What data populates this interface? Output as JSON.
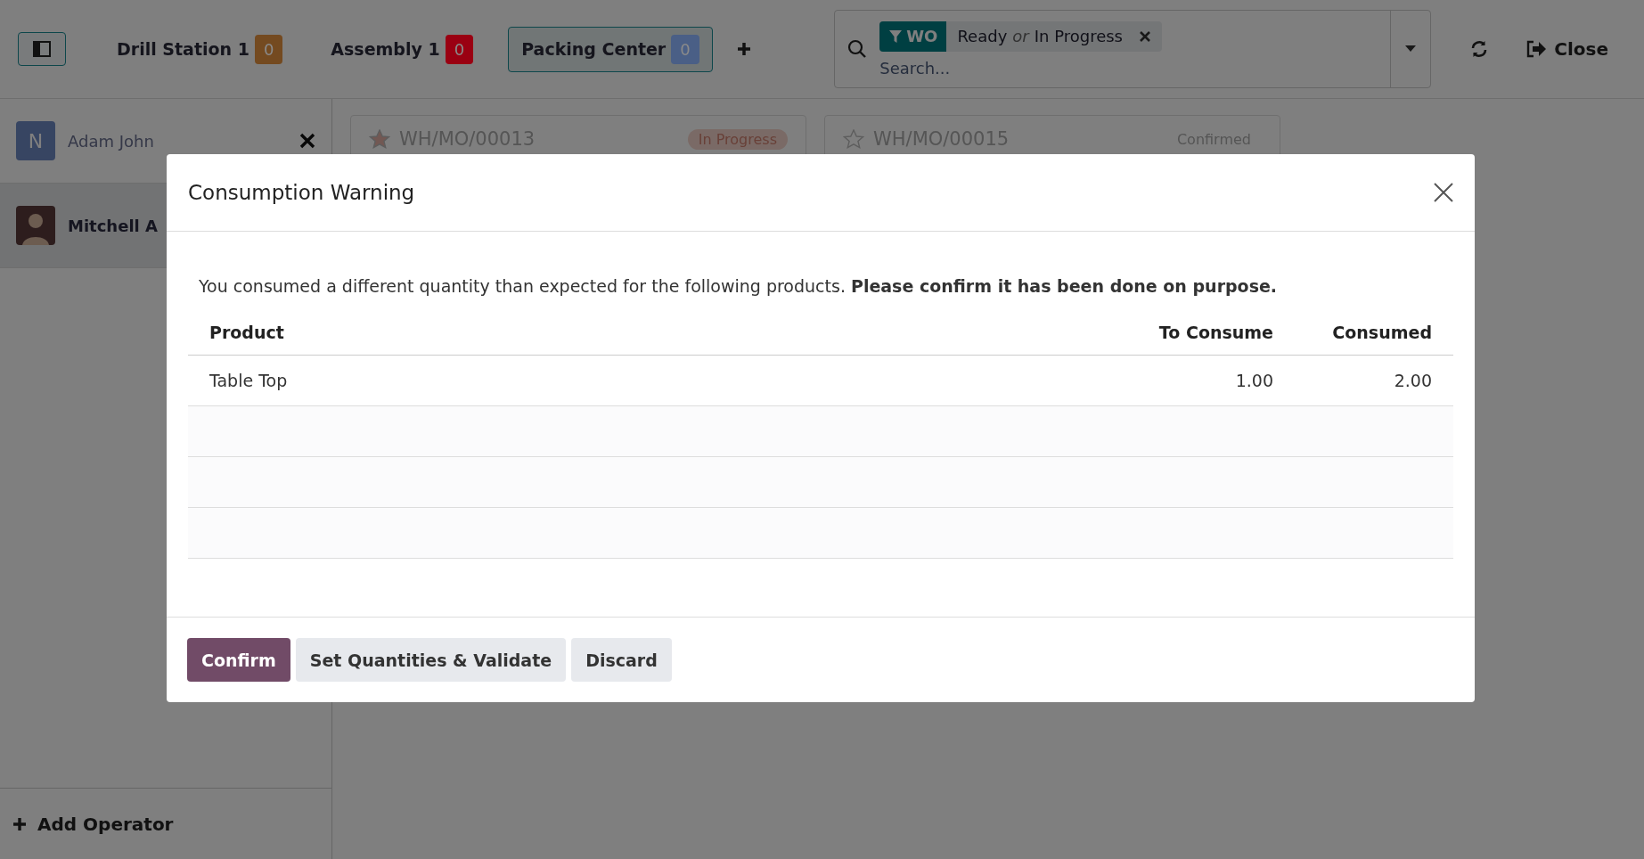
{
  "workcenters": [
    {
      "name": "Drill Station 1",
      "count": "0",
      "color": "#744a20",
      "selected": false
    },
    {
      "name": "Assembly 1",
      "count": "0",
      "color": "#9a0012",
      "selected": false
    },
    {
      "name": "Packing Center",
      "count": "0",
      "color": "#4a5f86",
      "selected": true
    }
  ],
  "search": {
    "facet_label": "WO",
    "facet_values": [
      {
        "kind": "value",
        "text": "Ready"
      },
      {
        "kind": "separator",
        "text": "or"
      },
      {
        "kind": "value",
        "text": "In Progress"
      }
    ],
    "placeholder": "Search..."
  },
  "close_label": "Close",
  "operators": [
    {
      "name": "Adam John",
      "avatar": "N",
      "kind": "letter",
      "selected": false
    },
    {
      "name": "Mitchell A",
      "kind": "photo",
      "selected": true
    }
  ],
  "add_operator": "Add Operator",
  "cards": [
    {
      "reference": "WH/MO/00013",
      "status": "In Progress",
      "kind": "progress"
    },
    {
      "reference": "WH/MO/00015",
      "status": "Confirmed",
      "kind": "confirmed"
    }
  ],
  "dialog": {
    "title": "Consumption Warning",
    "message": "You consumed a different quantity than expected for the following products. **Please confirm it has been done on purpose.**",
    "columns": [
      "Product",
      "To Consume",
      "Consumed"
    ],
    "rows": [
      [
        "Table Top",
        "1.00",
        "2.00"
      ]
    ],
    "buttons": [
      {
        "label": "Confirm",
        "kind": "primary"
      },
      {
        "label": "Set Quantities & Validate",
        "kind": "secondary"
      },
      {
        "label": "Discard",
        "kind": "secondary"
      }
    ]
  }
}
